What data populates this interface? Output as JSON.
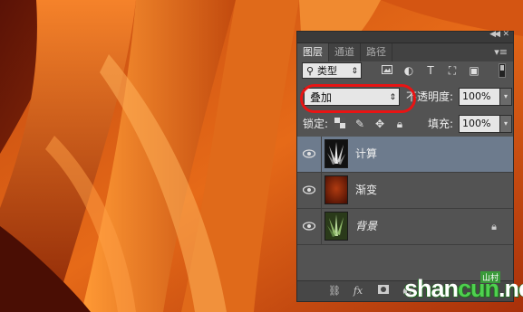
{
  "panel": {
    "tabs": [
      {
        "label": "图层",
        "active": true
      },
      {
        "label": "通道",
        "active": false
      },
      {
        "label": "路径",
        "active": false
      }
    ],
    "filter": {
      "label": "类型"
    },
    "blend_mode": {
      "value": "叠加"
    },
    "opacity": {
      "label": "不透明度:",
      "value": "100%"
    },
    "lock": {
      "label": "锁定:"
    },
    "fill": {
      "label": "填充:",
      "value": "100%"
    },
    "layers": [
      {
        "name": "计算",
        "selected": true,
        "visible": true,
        "locked": false
      },
      {
        "name": "渐变",
        "selected": false,
        "visible": true,
        "locked": false
      },
      {
        "name": "背景",
        "selected": false,
        "visible": true,
        "locked": true
      }
    ],
    "bottom_icons": [
      "link-icon",
      "fx-icon",
      "mask-icon",
      "adjustment-icon",
      "group-folder-icon",
      "new-layer-icon",
      "trash-icon"
    ]
  },
  "watermark": {
    "text_a": "shan",
    "text_b": "cun",
    "text_c": ".net",
    "sub": "山村"
  },
  "colors": {
    "selected_layer": "#6d7b8d",
    "panel_bg": "#535353",
    "highlight": "#e81414",
    "watermark_green": "#4fd04f"
  }
}
